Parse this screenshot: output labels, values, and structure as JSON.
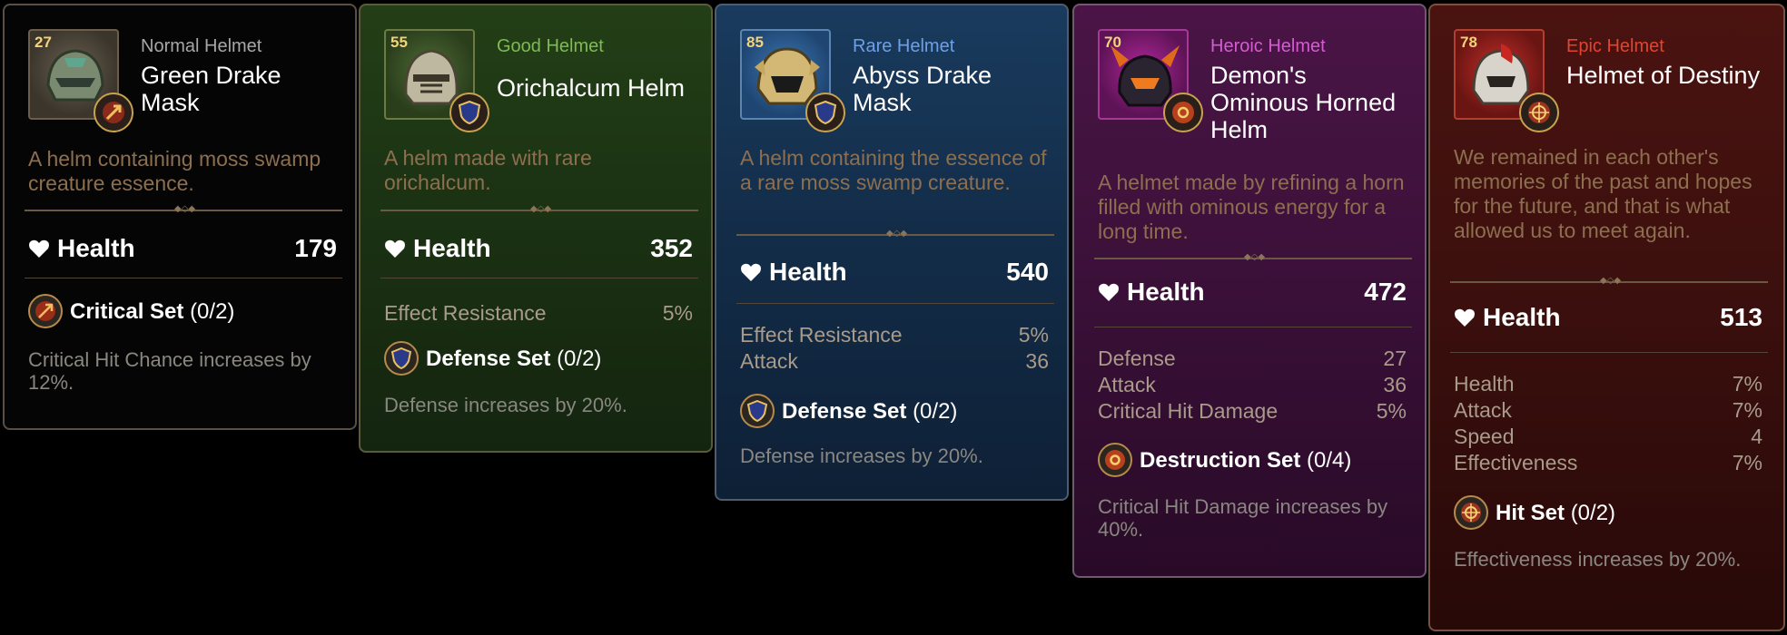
{
  "cards": [
    {
      "level": "27",
      "grade": "Normal Helmet",
      "name": "Green Drake Mask",
      "description": "A helm containing moss swamp creature essence.",
      "main_stat": {
        "label": "Health",
        "value": "179"
      },
      "sub_stats": [],
      "set": {
        "name": "Critical Set",
        "count": "(0/2)",
        "icon": "critical-set-icon",
        "description": "Critical Hit Chance increases by 12%."
      },
      "color": "#a7a7a7"
    },
    {
      "level": "55",
      "grade": "Good Helmet",
      "name": "Orichalcum Helm",
      "description": "A helm made with rare orichalcum.",
      "main_stat": {
        "label": "Health",
        "value": "352"
      },
      "sub_stats": [
        {
          "label": "Effect Resistance",
          "value": "5%"
        }
      ],
      "set": {
        "name": "Defense Set",
        "count": "(0/2)",
        "icon": "defense-set-icon",
        "description": "Defense increases by 20%."
      },
      "color": "#7fbb54"
    },
    {
      "level": "85",
      "grade": "Rare Helmet",
      "name": "Abyss Drake Mask",
      "description": "A helm containing the essence of a rare moss swamp creature.",
      "main_stat": {
        "label": "Health",
        "value": "540"
      },
      "sub_stats": [
        {
          "label": "Effect Resistance",
          "value": "5%"
        },
        {
          "label": "Attack",
          "value": "36"
        }
      ],
      "set": {
        "name": "Defense Set",
        "count": "(0/2)",
        "icon": "defense-set-icon",
        "description": "Defense increases by 20%."
      },
      "color": "#6ea0e6"
    },
    {
      "level": "70",
      "grade": "Heroic Helmet",
      "name": "Demon's Ominous Horned Helm",
      "description": "A helmet made by refining a horn filled with ominous energy for a long time.",
      "main_stat": {
        "label": "Health",
        "value": "472"
      },
      "sub_stats": [
        {
          "label": "Defense",
          "value": "27"
        },
        {
          "label": "Attack",
          "value": "36"
        },
        {
          "label": "Critical Hit Damage",
          "value": "5%"
        }
      ],
      "set": {
        "name": "Destruction Set",
        "count": "(0/4)",
        "icon": "destruction-set-icon",
        "description": "Critical Hit Damage increases by 40%."
      },
      "color": "#d55bd2"
    },
    {
      "level": "78",
      "grade": "Epic Helmet",
      "name": "Helmet of Destiny",
      "description": "We remained in each other's memories of the past and hopes for the future, and that is what allowed us to meet again.",
      "main_stat": {
        "label": "Health",
        "value": "513"
      },
      "sub_stats": [
        {
          "label": "Health",
          "value": "7%"
        },
        {
          "label": "Attack",
          "value": "7%"
        },
        {
          "label": "Speed",
          "value": "4"
        },
        {
          "label": "Effectiveness",
          "value": "7%"
        }
      ],
      "set": {
        "name": "Hit Set",
        "count": "(0/2)",
        "icon": "hit-set-icon",
        "description": "Effectiveness increases by 20%."
      },
      "color": "#e4432f"
    }
  ]
}
